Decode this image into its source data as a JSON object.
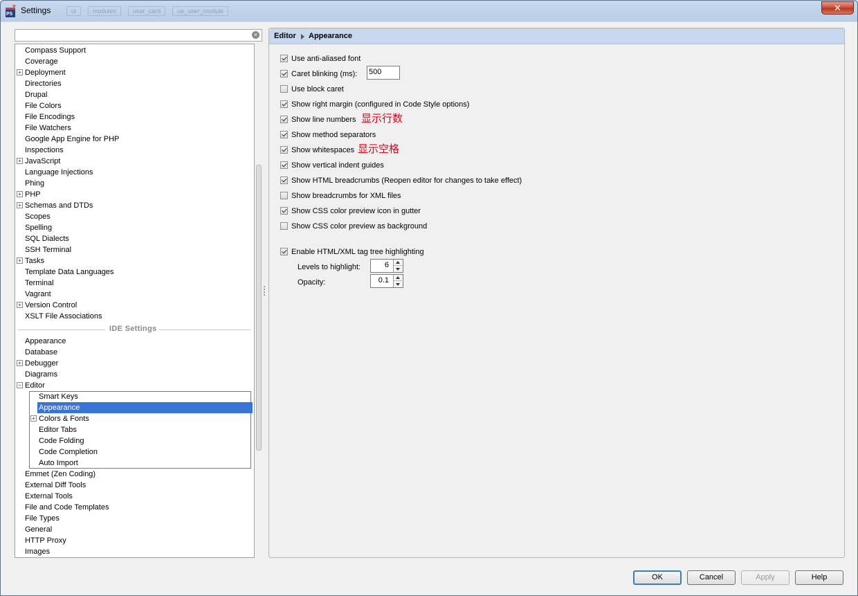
{
  "window": {
    "title": "Settings",
    "ghost_tabs": [
      "ui",
      "modules",
      "user_card",
      "ue_user_module"
    ]
  },
  "search": {
    "value": "",
    "placeholder": ""
  },
  "tree": {
    "items": [
      {
        "label": "Compass Support",
        "expandable": false
      },
      {
        "label": "Coverage",
        "expandable": false
      },
      {
        "label": "Deployment",
        "expandable": true
      },
      {
        "label": "Directories",
        "expandable": false
      },
      {
        "label": "Drupal",
        "expandable": false
      },
      {
        "label": "File Colors",
        "expandable": false
      },
      {
        "label": "File Encodings",
        "expandable": false
      },
      {
        "label": "File Watchers",
        "expandable": false
      },
      {
        "label": "Google App Engine for PHP",
        "expandable": false
      },
      {
        "label": "Inspections",
        "expandable": false
      },
      {
        "label": "JavaScript",
        "expandable": true
      },
      {
        "label": "Language Injections",
        "expandable": false
      },
      {
        "label": "Phing",
        "expandable": false
      },
      {
        "label": "PHP",
        "expandable": true
      },
      {
        "label": "Schemas and DTDs",
        "expandable": true
      },
      {
        "label": "Scopes",
        "expandable": false
      },
      {
        "label": "Spelling",
        "expandable": false
      },
      {
        "label": "SQL Dialects",
        "expandable": false
      },
      {
        "label": "SSH Terminal",
        "expandable": false
      },
      {
        "label": "Tasks",
        "expandable": true
      },
      {
        "label": "Template Data Languages",
        "expandable": false
      },
      {
        "label": "Terminal",
        "expandable": false
      },
      {
        "label": "Vagrant",
        "expandable": false
      },
      {
        "label": "Version Control",
        "expandable": true
      },
      {
        "label": "XSLT File Associations",
        "expandable": false
      }
    ],
    "ide_section_label": "IDE Settings",
    "ide_items": [
      {
        "label": "Appearance",
        "expandable": false
      },
      {
        "label": "Database",
        "expandable": false
      },
      {
        "label": "Debugger",
        "expandable": true
      },
      {
        "label": "Diagrams",
        "expandable": false
      },
      {
        "label": "Editor",
        "expandable": true,
        "expanded": true
      }
    ],
    "editor_children": [
      {
        "label": "Smart Keys",
        "expandable": false
      },
      {
        "label": "Appearance",
        "expandable": false,
        "selected": true
      },
      {
        "label": "Colors & Fonts",
        "expandable": true
      },
      {
        "label": "Editor Tabs",
        "expandable": false
      },
      {
        "label": "Code Folding",
        "expandable": false
      },
      {
        "label": "Code Completion",
        "expandable": false
      },
      {
        "label": "Auto Import",
        "expandable": false
      }
    ],
    "after_items": [
      {
        "label": "Emmet (Zen Coding)",
        "expandable": false
      },
      {
        "label": "External Diff Tools",
        "expandable": false
      },
      {
        "label": "External Tools",
        "expandable": false
      },
      {
        "label": "File and Code Templates",
        "expandable": false
      },
      {
        "label": "File Types",
        "expandable": false
      },
      {
        "label": "General",
        "expandable": false
      },
      {
        "label": "HTTP Proxy",
        "expandable": false
      },
      {
        "label": "Images",
        "expandable": false
      }
    ]
  },
  "breadcrumb": {
    "parent": "Editor",
    "current": "Appearance"
  },
  "options": [
    {
      "label": "Use anti-aliased font",
      "checked": true
    },
    {
      "label": "Caret blinking (ms):",
      "checked": true,
      "input_value": "500"
    },
    {
      "label": "Use block caret",
      "checked": false
    },
    {
      "label": "Show right margin (configured in Code Style options)",
      "checked": true
    },
    {
      "label": "Show line numbers",
      "checked": true,
      "annotation": "显示行数"
    },
    {
      "label": "Show method separators",
      "checked": true
    },
    {
      "label": "Show whitespaces",
      "checked": true,
      "annotation": "显示空格"
    },
    {
      "label": "Show vertical indent guides",
      "checked": true
    },
    {
      "label": "Show HTML breadcrumbs (Reopen editor for changes to take effect)",
      "checked": true
    },
    {
      "label": "Show breadcrumbs for XML files",
      "checked": false
    },
    {
      "label": "Show CSS color preview icon in gutter",
      "checked": true
    },
    {
      "label": "Show CSS color preview as background",
      "checked": false
    }
  ],
  "tag_tree": {
    "label": "Enable HTML/XML tag tree highlighting",
    "checked": true,
    "levels_label": "Levels to highlight:",
    "levels_value": "6",
    "opacity_label": "Opacity:",
    "opacity_value": "0.1"
  },
  "buttons": {
    "ok": "OK",
    "cancel": "Cancel",
    "apply": "Apply",
    "help": "Help"
  },
  "colors": {
    "selection": "#3875d7",
    "header": "#c6d7ee",
    "annotation": "#e1001a"
  }
}
